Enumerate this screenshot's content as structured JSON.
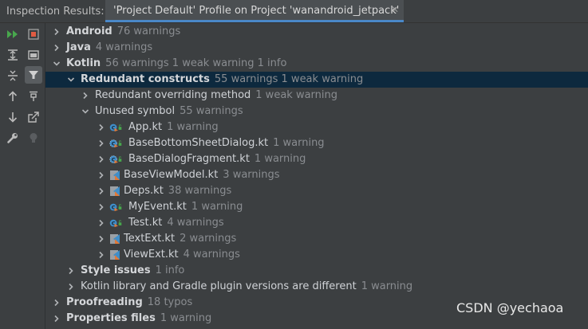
{
  "title": "Inspection Results:",
  "tab": {
    "label": "'Project Default' Profile on Project 'wanandroid_jetpack'",
    "close": "✕"
  },
  "colors": {
    "background": "#3c3f41",
    "selected_row": "#0d293e",
    "tab_underline": "#4a88c7",
    "count_text": "#8a8d91",
    "run_green": "#48a84d",
    "kotlin_file_blue": "#3f8ec9"
  },
  "toolbar": [
    {
      "name": "rerun-icon",
      "interactable": true
    },
    {
      "name": "stop-icon",
      "interactable": true
    },
    {
      "name": "expand-all-icon",
      "interactable": true
    },
    {
      "name": "group-icon",
      "interactable": true
    },
    {
      "name": "collapse-all-icon",
      "interactable": true
    },
    {
      "name": "filter-icon",
      "interactable": true
    },
    {
      "name": "previous-occurrence-icon",
      "interactable": true
    },
    {
      "name": "pin-icon",
      "interactable": true
    },
    {
      "name": "next-occurrence-icon",
      "interactable": true
    },
    {
      "name": "export-icon",
      "interactable": true
    },
    {
      "name": "settings-wrench-icon",
      "interactable": true
    },
    {
      "name": "bulb-icon",
      "interactable": false
    }
  ],
  "tree": [
    {
      "label": "Android",
      "count": "76 warnings",
      "expanded": false,
      "bold": true
    },
    {
      "label": "Java",
      "count": "4 warnings",
      "expanded": false,
      "bold": true
    },
    {
      "label": "Kotlin",
      "count": "56 warnings 1 weak warning 1 info",
      "expanded": true,
      "bold": true
    },
    {
      "label": "Redundant constructs",
      "count": "55 warnings 1 weak warning",
      "expanded": true,
      "bold": true,
      "selected": true
    },
    {
      "label": "Redundant overriding method",
      "count": "1 weak warning",
      "expanded": false,
      "bold": false
    },
    {
      "label": "Unused symbol",
      "count": "55 warnings",
      "expanded": true,
      "bold": false
    },
    {
      "label": "App.kt",
      "count": "1 warning",
      "expanded": false,
      "icon": "kotlin-class-icon"
    },
    {
      "label": "BaseBottomSheetDialog.kt",
      "count": "1 warning",
      "expanded": false,
      "icon": "kotlin-abstract-class-icon"
    },
    {
      "label": "BaseDialogFragment.kt",
      "count": "1 warning",
      "expanded": false,
      "icon": "kotlin-abstract-class-icon"
    },
    {
      "label": "BaseViewModel.kt",
      "count": "3 warnings",
      "expanded": false,
      "icon": "kotlin-file-icon"
    },
    {
      "label": "Deps.kt",
      "count": "38 warnings",
      "expanded": false,
      "icon": "kotlin-file-icon"
    },
    {
      "label": "MyEvent.kt",
      "count": "1 warning",
      "expanded": false,
      "icon": "kotlin-class-icon"
    },
    {
      "label": "Test.kt",
      "count": "4 warnings",
      "expanded": false,
      "icon": "kotlin-class-icon"
    },
    {
      "label": "TextExt.kt",
      "count": "2 warnings",
      "expanded": false,
      "icon": "kotlin-file-icon"
    },
    {
      "label": "ViewExt.kt",
      "count": "4 warnings",
      "expanded": false,
      "icon": "kotlin-file-icon"
    },
    {
      "label": "Style issues",
      "count": "1 info",
      "expanded": false,
      "bold": true
    },
    {
      "label": "Kotlin library and Gradle plugin versions are different",
      "count": "1 warning",
      "expanded": false,
      "bold": false
    },
    {
      "label": "Proofreading",
      "count": "18 typos",
      "expanded": false,
      "bold": true
    },
    {
      "label": "Properties files",
      "count": "1 warning",
      "expanded": false,
      "bold": true
    }
  ],
  "watermark": "CSDN @yechaoa"
}
